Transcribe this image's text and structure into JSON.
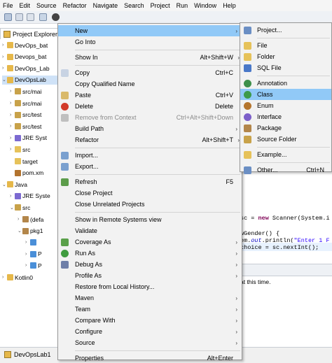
{
  "menubar": [
    "File",
    "Edit",
    "Source",
    "Refactor",
    "Navigate",
    "Search",
    "Project",
    "Run",
    "Window",
    "Help"
  ],
  "explorer": {
    "title": "Project Explorer",
    "tree": [
      {
        "label": "DevOps_bat",
        "indent": 0,
        "twisty": ">",
        "color": "#e6b84a"
      },
      {
        "label": "Devops_bat",
        "indent": 0,
        "twisty": ">",
        "color": "#e6b84a"
      },
      {
        "label": "DevOps_Lab",
        "indent": 0,
        "twisty": ">",
        "color": "#e6b84a"
      },
      {
        "label": "DevOpsLab",
        "indent": 0,
        "twisty": "v",
        "color": "#e6b84a",
        "selected": true
      },
      {
        "label": "src/mai",
        "indent": 1,
        "twisty": ">",
        "color": "#c8a24a"
      },
      {
        "label": "src/mai",
        "indent": 1,
        "twisty": ">",
        "color": "#c8a24a"
      },
      {
        "label": "src/test",
        "indent": 1,
        "twisty": ">",
        "color": "#c8a24a"
      },
      {
        "label": "src/test",
        "indent": 1,
        "twisty": ">",
        "color": "#c8a24a"
      },
      {
        "label": "JRE Syst",
        "indent": 1,
        "twisty": ">",
        "color": "#7c6ad1"
      },
      {
        "label": "src",
        "indent": 1,
        "twisty": ">",
        "color": "#e6c25a"
      },
      {
        "label": "target",
        "indent": 1,
        "twisty": "",
        "color": "#e6c25a"
      },
      {
        "label": "pom.xm",
        "indent": 1,
        "twisty": "",
        "color": "#b2732e"
      },
      {
        "label": "Java",
        "indent": 0,
        "twisty": "v",
        "color": "#e6b84a"
      },
      {
        "label": "JRE Syste",
        "indent": 1,
        "twisty": ">",
        "color": "#7c6ad1"
      },
      {
        "label": "src",
        "indent": 1,
        "twisty": "v",
        "color": "#c8a24a"
      },
      {
        "label": "(defa",
        "indent": 2,
        "twisty": ">",
        "color": "#b3864a"
      },
      {
        "label": "pkg1",
        "indent": 2,
        "twisty": "v",
        "color": "#b3864a"
      },
      {
        "label": "",
        "indent": 3,
        "twisty": ">",
        "color": "#4a8fd8"
      },
      {
        "label": "P",
        "indent": 3,
        "twisty": ">",
        "color": "#4a8fd8"
      },
      {
        "label": "P",
        "indent": 3,
        "twisty": ">",
        "color": "#4a8fd8"
      },
      {
        "label": "Kotlin0",
        "indent": 0,
        "twisty": ">",
        "color": "#e6b84a"
      }
    ]
  },
  "context_menu": {
    "items": [
      {
        "label": "New",
        "shortcut": "",
        "arrow": true,
        "highlight": true,
        "icon": ""
      },
      {
        "label": "Go Into",
        "shortcut": "",
        "arrow": false,
        "icon": ""
      },
      {
        "sep": true
      },
      {
        "label": "Show In",
        "shortcut": "Alt+Shift+W",
        "arrow": true,
        "icon": ""
      },
      {
        "sep": true
      },
      {
        "label": "Copy",
        "shortcut": "Ctrl+C",
        "arrow": false,
        "icon": "copy-icon"
      },
      {
        "label": "Copy Qualified Name",
        "shortcut": "",
        "arrow": false,
        "icon": ""
      },
      {
        "label": "Paste",
        "shortcut": "Ctrl+V",
        "arrow": false,
        "icon": "paste-icon"
      },
      {
        "label": "Delete",
        "shortcut": "Delete",
        "arrow": false,
        "icon": "delete-icon"
      },
      {
        "label": "Remove from Context",
        "shortcut": "Ctrl+Alt+Shift+Down",
        "arrow": false,
        "icon": "remove-context-icon",
        "disabled": true
      },
      {
        "label": "Build Path",
        "shortcut": "",
        "arrow": true,
        "icon": ""
      },
      {
        "label": "Refactor",
        "shortcut": "Alt+Shift+T",
        "arrow": true,
        "icon": ""
      },
      {
        "sep": true
      },
      {
        "label": "Import...",
        "shortcut": "",
        "arrow": false,
        "icon": "import-icon"
      },
      {
        "label": "Export...",
        "shortcut": "",
        "arrow": false,
        "icon": "export-icon"
      },
      {
        "sep": true
      },
      {
        "label": "Refresh",
        "shortcut": "F5",
        "arrow": false,
        "icon": "refresh-icon"
      },
      {
        "label": "Close Project",
        "shortcut": "",
        "arrow": false,
        "icon": ""
      },
      {
        "label": "Close Unrelated Projects",
        "shortcut": "",
        "arrow": false,
        "icon": ""
      },
      {
        "sep": true
      },
      {
        "label": "Show in Remote Systems view",
        "shortcut": "",
        "arrow": false,
        "icon": ""
      },
      {
        "label": "Validate",
        "shortcut": "",
        "arrow": false,
        "icon": ""
      },
      {
        "label": "Coverage As",
        "shortcut": "",
        "arrow": true,
        "icon": "coverage-icon"
      },
      {
        "label": "Run As",
        "shortcut": "",
        "arrow": true,
        "icon": "run-icon"
      },
      {
        "label": "Debug As",
        "shortcut": "",
        "arrow": true,
        "icon": "debug-icon"
      },
      {
        "label": "Profile As",
        "shortcut": "",
        "arrow": true,
        "icon": ""
      },
      {
        "label": "Restore from Local History...",
        "shortcut": "",
        "arrow": false,
        "icon": ""
      },
      {
        "label": "Maven",
        "shortcut": "",
        "arrow": true,
        "icon": ""
      },
      {
        "label": "Team",
        "shortcut": "",
        "arrow": true,
        "icon": ""
      },
      {
        "label": "Compare With",
        "shortcut": "",
        "arrow": true,
        "icon": ""
      },
      {
        "label": "Configure",
        "shortcut": "",
        "arrow": true,
        "icon": ""
      },
      {
        "label": "Source",
        "shortcut": "",
        "arrow": true,
        "icon": ""
      },
      {
        "sep": true
      },
      {
        "label": "Properties",
        "shortcut": "Alt+Enter",
        "arrow": false,
        "icon": ""
      }
    ]
  },
  "new_submenu": {
    "items": [
      {
        "label": "Project...",
        "shortcut": "",
        "icon": "project-icon",
        "color": "#6b8fc4"
      },
      {
        "sep": true
      },
      {
        "label": "File",
        "shortcut": "",
        "icon": "file-icon",
        "color": "#e6c25a"
      },
      {
        "label": "Folder",
        "shortcut": "",
        "icon": "folder-icon",
        "color": "#e6c25a"
      },
      {
        "label": "SQL File",
        "shortcut": "",
        "icon": "sql-file-icon",
        "color": "#4a78c8"
      },
      {
        "sep": true
      },
      {
        "label": "Annotation",
        "shortcut": "",
        "icon": "annotation-icon",
        "color": "#3d8f4a"
      },
      {
        "label": "Class",
        "shortcut": "",
        "icon": "class-icon",
        "color": "#3d9a4a",
        "highlight": true
      },
      {
        "label": "Enum",
        "shortcut": "",
        "icon": "enum-icon",
        "color": "#b5752d"
      },
      {
        "label": "Interface",
        "shortcut": "",
        "icon": "interface-icon",
        "color": "#7c5fc9"
      },
      {
        "label": "Package",
        "shortcut": "",
        "icon": "package-icon",
        "color": "#b3864a"
      },
      {
        "label": "Source Folder",
        "shortcut": "",
        "icon": "source-folder-icon",
        "color": "#c8a24a"
      },
      {
        "sep": true
      },
      {
        "label": "Example...",
        "shortcut": "",
        "icon": "example-icon",
        "color": "#e6c25a"
      },
      {
        "sep": true
      },
      {
        "label": "Other...",
        "shortcut": "Ctrl+N",
        "icon": "other-icon",
        "color": "#6b8fc4"
      }
    ]
  },
  "editor": {
    "line1_a": "sc",
    "line1_b": " = ",
    "line1_kw": "new",
    "line1_c": " Scanner(System.i",
    "line2": "wGender() {",
    "line3_a": "em.",
    "line3_fld": "out",
    "line3_b": ".println(",
    "line3_str": "\"Enter 1 F",
    "line4": "choice  = sc.nextInt();"
  },
  "console": {
    "text": "at this time."
  },
  "status": {
    "label": "DevOpsLab1"
  }
}
